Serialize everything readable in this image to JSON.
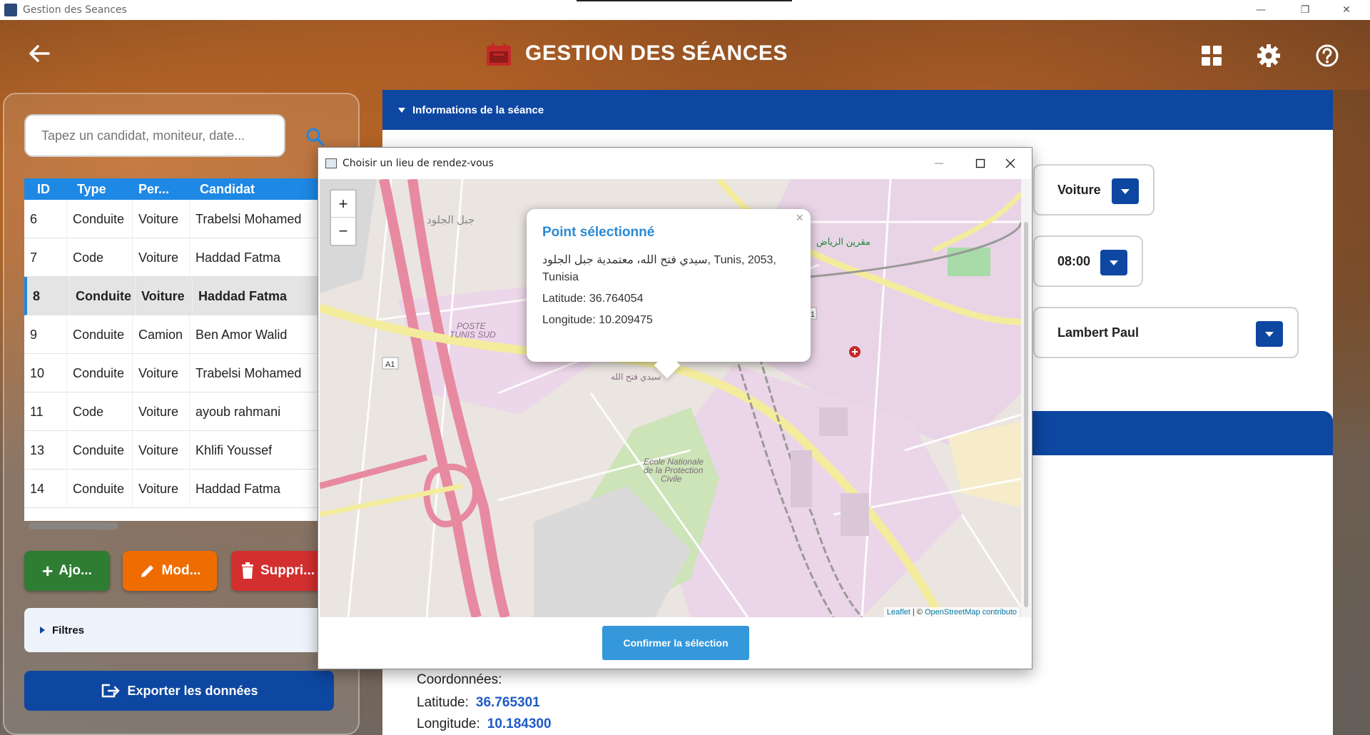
{
  "os_window": {
    "title": "Gestion des Seances",
    "minimize": "—",
    "restore": "❐",
    "close": "✕"
  },
  "header": {
    "title": "GESTION DES SÉANCES"
  },
  "search": {
    "placeholder": "Tapez un candidat, moniteur, date..."
  },
  "table": {
    "columns": [
      "ID",
      "Type",
      "Per...",
      "Candidat"
    ],
    "rows": [
      {
        "id": "6",
        "type": "Conduite",
        "per": "Voiture",
        "candidat": "Trabelsi Mohamed"
      },
      {
        "id": "7",
        "type": "Code",
        "per": "Voiture",
        "candidat": "Haddad Fatma"
      },
      {
        "id": "8",
        "type": "Conduite",
        "per": "Voiture",
        "candidat": "Haddad Fatma",
        "selected": true
      },
      {
        "id": "9",
        "type": "Conduite",
        "per": "Camion",
        "candidat": "Ben Amor Walid"
      },
      {
        "id": "10",
        "type": "Conduite",
        "per": "Voiture",
        "candidat": "Trabelsi Mohamed"
      },
      {
        "id": "11",
        "type": "Code",
        "per": "Voiture",
        "candidat": "ayoub rahmani"
      },
      {
        "id": "13",
        "type": "Conduite",
        "per": "Voiture",
        "candidat": "Khlifi Youssef"
      },
      {
        "id": "14",
        "type": "Conduite",
        "per": "Voiture",
        "candidat": "Haddad Fatma"
      }
    ]
  },
  "actions": {
    "add": "Ajo...",
    "edit": "Mod...",
    "delete": "Suppri..."
  },
  "filters": {
    "label": "Filtres"
  },
  "export": {
    "label": "Exporter les données"
  },
  "info_section": {
    "title": "Informations de la séance"
  },
  "form": {
    "vehicle": "Voiture",
    "time": "08:00",
    "moniteur": "Lambert Paul"
  },
  "coordinates": {
    "label": "Coordonnées:",
    "latitude_label": "Latitude:",
    "latitude": "36.765301",
    "longitude_label": "Longitude:",
    "longitude": "10.184300"
  },
  "dialog": {
    "title": "Choisir un lieu de rendez-vous",
    "popup": {
      "title": "Point sélectionné",
      "address": "سيدي فتح الله، معتمدية جبل الجلود, Tunis, 2053, Tunisia",
      "latitude": "Latitude: 36.764054",
      "longitude": "Longitude: 10.209475",
      "close": "×"
    },
    "zoom_in": "+",
    "zoom_out": "−",
    "attribution_leaflet": "Leaflet",
    "attribution_sep": " | © ",
    "attribution_osm": "OpenStreetMap contributo",
    "confirm": "Confirmer la sélection"
  },
  "map_labels": {
    "jebel_jelloud": "جبل الجلود",
    "poste": "POSTE",
    "tunis_sud": "TUNIS SUD",
    "sidi_fathallah": "سيدي فتح الله",
    "ecole": "Ecole Nationale",
    "ecole2": "de la Protection",
    "ecole3": "Civile",
    "rn1": "RN1",
    "a1": "A1",
    "megrine_riadh": "مقرين الرياض"
  },
  "colors": {
    "primary": "#0d47a1",
    "table_header": "#1e88e5",
    "add": "#2e7d32",
    "edit": "#ef6c00",
    "delete": "#d32f2f",
    "confirm": "#3498db"
  }
}
